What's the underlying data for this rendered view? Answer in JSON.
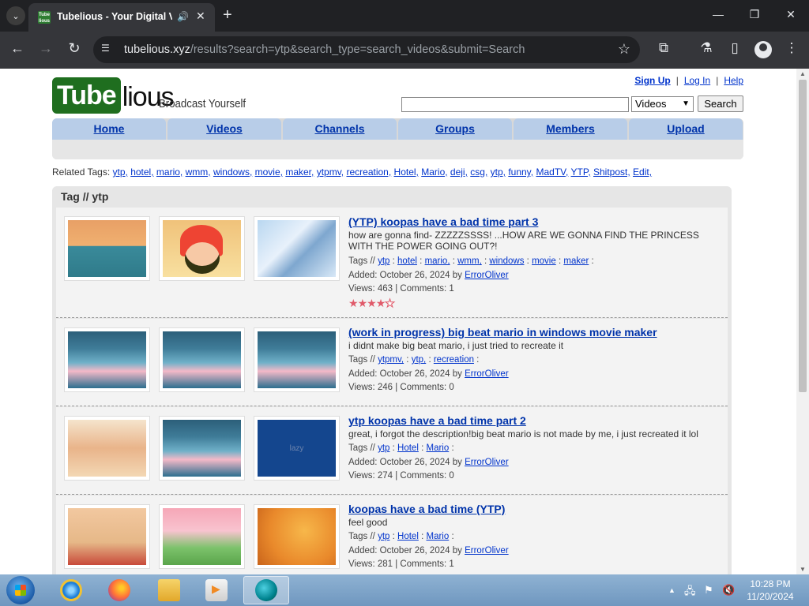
{
  "browser": {
    "tab_title": "Tubelious - Your Digital Vi",
    "favicon_text": "Tube lious",
    "url_host": "tubelious.xyz",
    "url_path": "/results?search=ytp&search_type=search_videos&submit=Search"
  },
  "site": {
    "logo_tube": "Tube",
    "logo_rest": "lious",
    "slogan": "Broadcast Yourself",
    "top_links": {
      "signup": "Sign Up",
      "login": "Log In",
      "help": "Help",
      "sep": "|"
    },
    "search": {
      "value": "",
      "type_selected": "Videos",
      "button": "Search"
    },
    "nav": [
      "Home",
      "Videos",
      "Channels",
      "Groups",
      "Members",
      "Upload"
    ],
    "related_label": "Related Tags:",
    "related_tags": [
      "ytp,",
      "hotel,",
      "mario,",
      "wmm,",
      "windows,",
      "movie,",
      "maker,",
      "ytpmv,",
      "recreation,",
      "Hotel,",
      "Mario,",
      "deji,",
      "csg,",
      "ytp,",
      "funny,",
      "MadTV,",
      "YTP,",
      "Shitpost,",
      "Edit,"
    ],
    "tag_header": "Tag // ytp"
  },
  "videos": [
    {
      "title": "(YTP) koopas have a bad time part 3",
      "description": "how are gonna find- ZZZZZSSSS! ...HOW ARE WE GONNA FIND THE PRINCESS WITH THE POWER GOING OUT?!",
      "tags_label": "Tags //",
      "tags": [
        "ytp",
        "hotel",
        "mario,",
        "wmm,",
        "windows",
        "movie",
        "maker"
      ],
      "added": "Added: October 26, 2024 by",
      "author": "ErrorOliver",
      "stats": "Views: 463 | Comments: 1",
      "rating": 4,
      "thumbs": [
        "art-sea",
        "art-mario",
        "art-snow"
      ]
    },
    {
      "title": "(work in progress) big beat mario in windows movie maker",
      "description": "i didnt make big beat mario, i just tried to recreate it",
      "tags_label": "Tags //",
      "tags": [
        "ytpmv,",
        "ytp,",
        "recreation"
      ],
      "added": "Added: October 26, 2024 by",
      "author": "ErrorOliver",
      "stats": "Views: 246 | Comments: 0",
      "thumbs": [
        "art-tree",
        "art-tree",
        "art-tree"
      ]
    },
    {
      "title": "ytp koopas have a bad time part 2",
      "description": "great, i forgot the description!big beat mario is not made by me, i just recreated it lol",
      "tags_label": "Tags //",
      "tags": [
        "ytp",
        "Hotel",
        "Mario"
      ],
      "added": "Added: October 26, 2024 by",
      "author": "ErrorOliver",
      "stats": "Views: 274 | Comments: 0",
      "thumbs": [
        "art-hotel",
        "art-tree",
        "art-blue"
      ],
      "thumb_text": "lazy"
    },
    {
      "title": "koopas have a bad time (YTP)",
      "description": "feel good",
      "tags_label": "Tags //",
      "tags": [
        "ytp",
        "Hotel",
        "Mario"
      ],
      "added": "Added: October 26, 2024 by",
      "author": "ErrorOliver",
      "stats": "Views: 281 | Comments: 1",
      "thumbs": [
        "art-sign",
        "art-hills",
        "art-orange"
      ]
    }
  ],
  "taskbar": {
    "time": "10:28 PM",
    "date": "11/20/2024"
  }
}
